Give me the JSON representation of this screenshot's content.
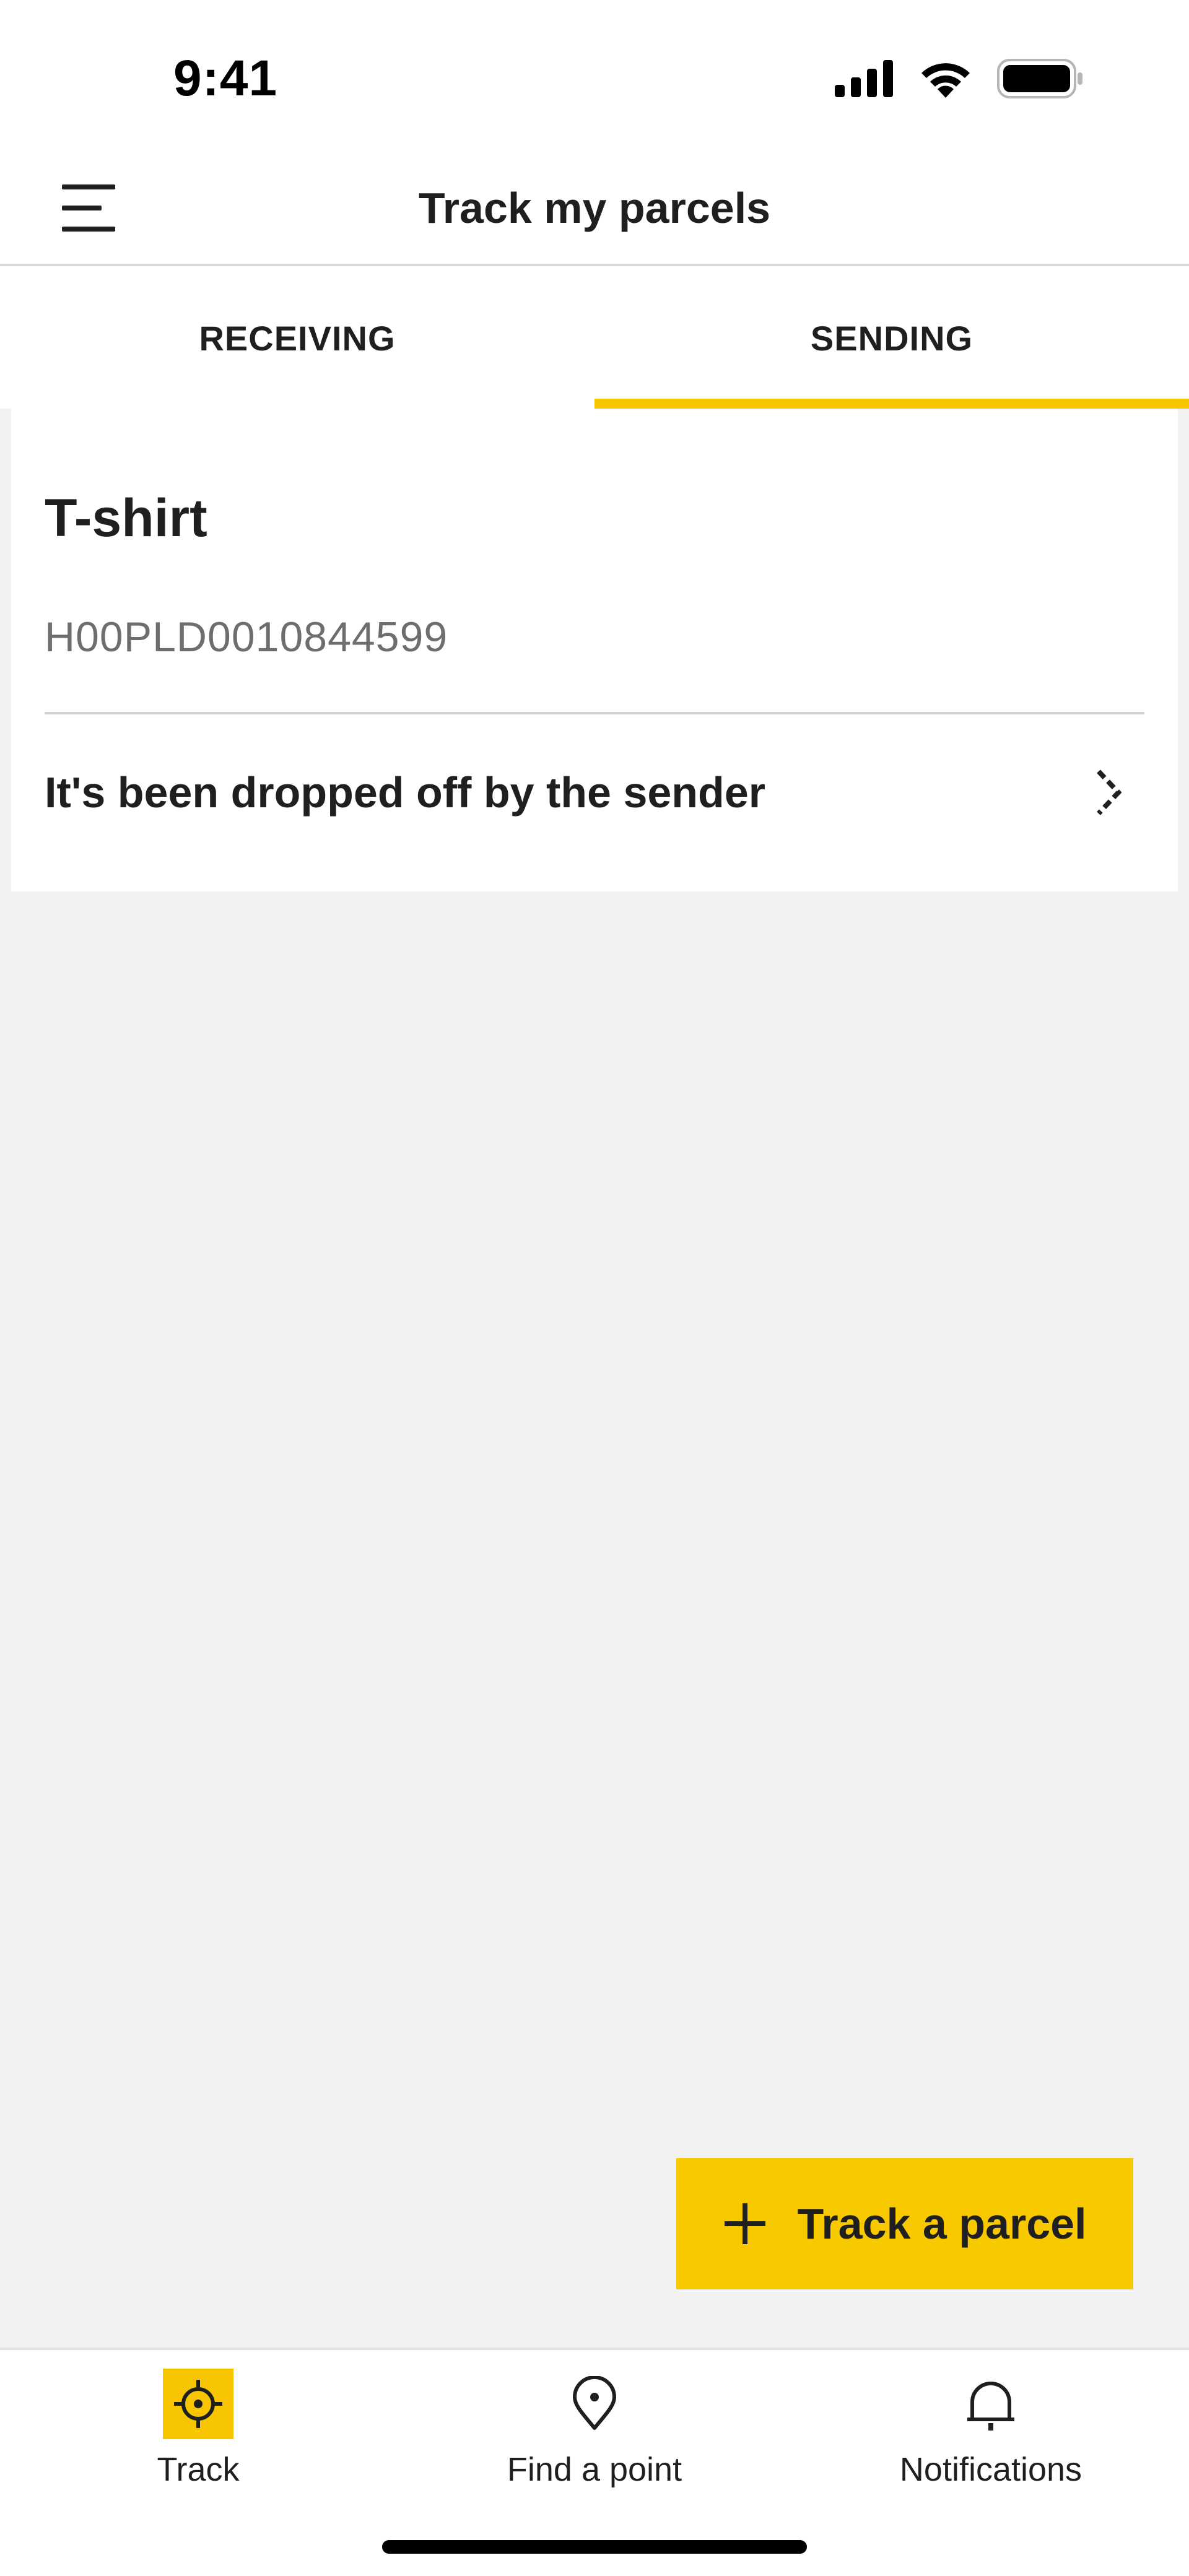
{
  "status_bar": {
    "time": "9:41",
    "icons": [
      "signal-icon",
      "wifi-icon",
      "battery-icon"
    ]
  },
  "header": {
    "title": "Track my parcels",
    "menu_icon": "hamburger-menu-icon"
  },
  "tabs": [
    {
      "label": "RECEIVING",
      "active": false
    },
    {
      "label": "SENDING",
      "active": true
    }
  ],
  "parcel": {
    "name": "T-shirt",
    "tracking_number": "H00PLD0010844599",
    "status": "It's been dropped off by the sender",
    "chevron_icon": "chevron-right-icon"
  },
  "track_button": {
    "label": "Track a parcel",
    "icon": "plus-icon"
  },
  "bottom_nav": [
    {
      "label": "Track",
      "icon": "crosshair-icon",
      "active": true
    },
    {
      "label": "Find a point",
      "icon": "map-pin-icon",
      "active": false
    },
    {
      "label": "Notifications",
      "icon": "bell-icon",
      "active": false
    }
  ],
  "colors": {
    "accent": "#F7C600",
    "background": "#F2F2F2",
    "card": "#FFFFFF",
    "text_primary": "#1F1F1F",
    "text_secondary": "#6E6E6E"
  }
}
